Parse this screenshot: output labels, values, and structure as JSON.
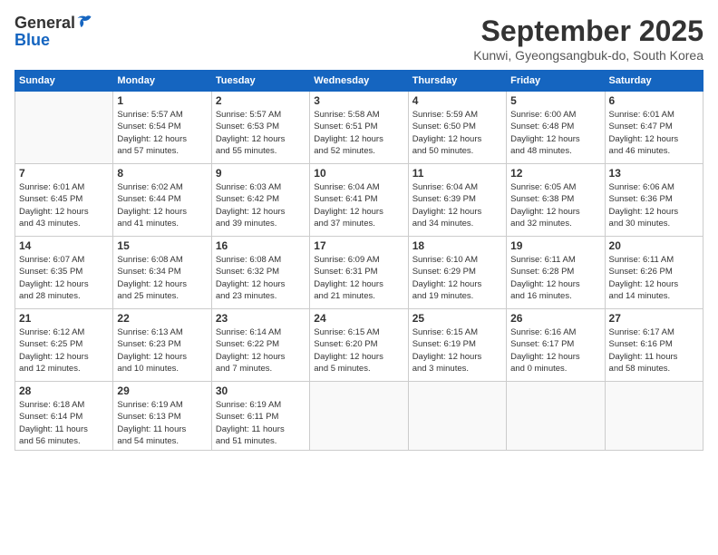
{
  "logo": {
    "general": "General",
    "blue": "Blue"
  },
  "title": "September 2025",
  "location": "Kunwi, Gyeongsangbuk-do, South Korea",
  "headers": [
    "Sunday",
    "Monday",
    "Tuesday",
    "Wednesday",
    "Thursday",
    "Friday",
    "Saturday"
  ],
  "weeks": [
    [
      {
        "day": "",
        "info": ""
      },
      {
        "day": "1",
        "info": "Sunrise: 5:57 AM\nSunset: 6:54 PM\nDaylight: 12 hours\nand 57 minutes."
      },
      {
        "day": "2",
        "info": "Sunrise: 5:57 AM\nSunset: 6:53 PM\nDaylight: 12 hours\nand 55 minutes."
      },
      {
        "day": "3",
        "info": "Sunrise: 5:58 AM\nSunset: 6:51 PM\nDaylight: 12 hours\nand 52 minutes."
      },
      {
        "day": "4",
        "info": "Sunrise: 5:59 AM\nSunset: 6:50 PM\nDaylight: 12 hours\nand 50 minutes."
      },
      {
        "day": "5",
        "info": "Sunrise: 6:00 AM\nSunset: 6:48 PM\nDaylight: 12 hours\nand 48 minutes."
      },
      {
        "day": "6",
        "info": "Sunrise: 6:01 AM\nSunset: 6:47 PM\nDaylight: 12 hours\nand 46 minutes."
      }
    ],
    [
      {
        "day": "7",
        "info": "Sunrise: 6:01 AM\nSunset: 6:45 PM\nDaylight: 12 hours\nand 43 minutes."
      },
      {
        "day": "8",
        "info": "Sunrise: 6:02 AM\nSunset: 6:44 PM\nDaylight: 12 hours\nand 41 minutes."
      },
      {
        "day": "9",
        "info": "Sunrise: 6:03 AM\nSunset: 6:42 PM\nDaylight: 12 hours\nand 39 minutes."
      },
      {
        "day": "10",
        "info": "Sunrise: 6:04 AM\nSunset: 6:41 PM\nDaylight: 12 hours\nand 37 minutes."
      },
      {
        "day": "11",
        "info": "Sunrise: 6:04 AM\nSunset: 6:39 PM\nDaylight: 12 hours\nand 34 minutes."
      },
      {
        "day": "12",
        "info": "Sunrise: 6:05 AM\nSunset: 6:38 PM\nDaylight: 12 hours\nand 32 minutes."
      },
      {
        "day": "13",
        "info": "Sunrise: 6:06 AM\nSunset: 6:36 PM\nDaylight: 12 hours\nand 30 minutes."
      }
    ],
    [
      {
        "day": "14",
        "info": "Sunrise: 6:07 AM\nSunset: 6:35 PM\nDaylight: 12 hours\nand 28 minutes."
      },
      {
        "day": "15",
        "info": "Sunrise: 6:08 AM\nSunset: 6:34 PM\nDaylight: 12 hours\nand 25 minutes."
      },
      {
        "day": "16",
        "info": "Sunrise: 6:08 AM\nSunset: 6:32 PM\nDaylight: 12 hours\nand 23 minutes."
      },
      {
        "day": "17",
        "info": "Sunrise: 6:09 AM\nSunset: 6:31 PM\nDaylight: 12 hours\nand 21 minutes."
      },
      {
        "day": "18",
        "info": "Sunrise: 6:10 AM\nSunset: 6:29 PM\nDaylight: 12 hours\nand 19 minutes."
      },
      {
        "day": "19",
        "info": "Sunrise: 6:11 AM\nSunset: 6:28 PM\nDaylight: 12 hours\nand 16 minutes."
      },
      {
        "day": "20",
        "info": "Sunrise: 6:11 AM\nSunset: 6:26 PM\nDaylight: 12 hours\nand 14 minutes."
      }
    ],
    [
      {
        "day": "21",
        "info": "Sunrise: 6:12 AM\nSunset: 6:25 PM\nDaylight: 12 hours\nand 12 minutes."
      },
      {
        "day": "22",
        "info": "Sunrise: 6:13 AM\nSunset: 6:23 PM\nDaylight: 12 hours\nand 10 minutes."
      },
      {
        "day": "23",
        "info": "Sunrise: 6:14 AM\nSunset: 6:22 PM\nDaylight: 12 hours\nand 7 minutes."
      },
      {
        "day": "24",
        "info": "Sunrise: 6:15 AM\nSunset: 6:20 PM\nDaylight: 12 hours\nand 5 minutes."
      },
      {
        "day": "25",
        "info": "Sunrise: 6:15 AM\nSunset: 6:19 PM\nDaylight: 12 hours\nand 3 minutes."
      },
      {
        "day": "26",
        "info": "Sunrise: 6:16 AM\nSunset: 6:17 PM\nDaylight: 12 hours\nand 0 minutes."
      },
      {
        "day": "27",
        "info": "Sunrise: 6:17 AM\nSunset: 6:16 PM\nDaylight: 11 hours\nand 58 minutes."
      }
    ],
    [
      {
        "day": "28",
        "info": "Sunrise: 6:18 AM\nSunset: 6:14 PM\nDaylight: 11 hours\nand 56 minutes."
      },
      {
        "day": "29",
        "info": "Sunrise: 6:19 AM\nSunset: 6:13 PM\nDaylight: 11 hours\nand 54 minutes."
      },
      {
        "day": "30",
        "info": "Sunrise: 6:19 AM\nSunset: 6:11 PM\nDaylight: 11 hours\nand 51 minutes."
      },
      {
        "day": "",
        "info": ""
      },
      {
        "day": "",
        "info": ""
      },
      {
        "day": "",
        "info": ""
      },
      {
        "day": "",
        "info": ""
      }
    ]
  ]
}
